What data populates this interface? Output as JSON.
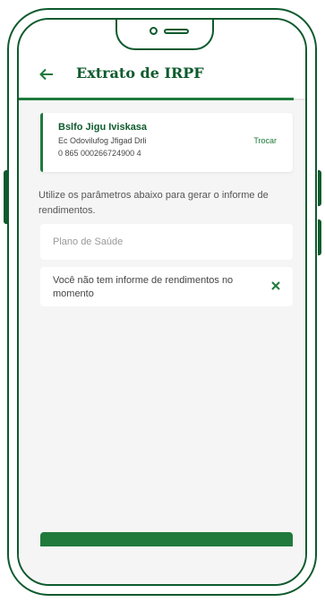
{
  "header": {
    "back_icon": "arrow-left-icon",
    "title": "Extrato de IRPF",
    "progress": 0.96
  },
  "account": {
    "name": "Bslfo Jigu Iviskasa",
    "line1": "Ec Odovilufog Jfigad Drli",
    "line2": "0 865 000266724900 4",
    "change_label": "Trocar"
  },
  "description": "Utilize os parâmetros abaixo para gerar o informe de rendimentos.",
  "select": {
    "placeholder": "Plano de Saúde"
  },
  "notice": {
    "text": "Você não tem informe de rendimentos no momento",
    "close_icon": "close-icon"
  },
  "colors": {
    "accent": "#1f7a3c",
    "dark_green": "#0e5a2e",
    "background": "#f5f5f5"
  }
}
